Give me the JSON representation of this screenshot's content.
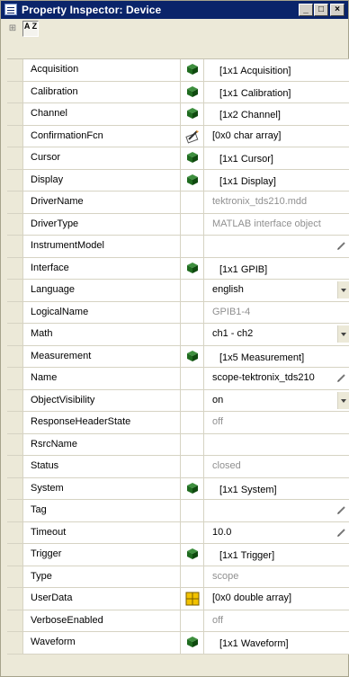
{
  "window": {
    "title": "Property Inspector:  Device",
    "buttons": [
      "_",
      "□",
      "×"
    ]
  },
  "toolbar": {
    "categorized_label": "⊞",
    "sort_label": "A Z"
  },
  "properties": [
    {
      "name": "Acquisition",
      "icon": "cube",
      "value": "[1x1 Acquisition]",
      "style": "sub"
    },
    {
      "name": "Calibration",
      "icon": "cube",
      "value": "[1x1 Calibration]",
      "style": "sub"
    },
    {
      "name": "Channel",
      "icon": "cube",
      "value": "[1x2 Channel]",
      "style": "sub"
    },
    {
      "name": "ConfirmationFcn",
      "icon": "edit",
      "value": "[0x0  char array]",
      "style": "normal"
    },
    {
      "name": "Cursor",
      "icon": "cube",
      "value": "[1x1 Cursor]",
      "style": "sub"
    },
    {
      "name": "Display",
      "icon": "cube",
      "value": "[1x1 Display]",
      "style": "sub"
    },
    {
      "name": "DriverName",
      "icon": "",
      "value": "tektronix_tds210.mdd",
      "style": "ro"
    },
    {
      "name": "DriverType",
      "icon": "",
      "value": "MATLAB interface object",
      "style": "ro"
    },
    {
      "name": "InstrumentModel",
      "icon": "",
      "value": "",
      "style": "normal",
      "pencil": true
    },
    {
      "name": "Interface",
      "icon": "cube",
      "value": "[1x1 GPIB]",
      "style": "sub"
    },
    {
      "name": "Language",
      "icon": "",
      "value": "english",
      "style": "normal",
      "dropdown": true
    },
    {
      "name": "LogicalName",
      "icon": "",
      "value": "GPIB1-4",
      "style": "ro"
    },
    {
      "name": "Math",
      "icon": "",
      "value": "ch1 - ch2",
      "style": "normal",
      "dropdown": true
    },
    {
      "name": "Measurement",
      "icon": "cube",
      "value": "[1x5 Measurement]",
      "style": "sub"
    },
    {
      "name": "Name",
      "icon": "",
      "value": "scope-tektronix_tds210",
      "style": "normal",
      "pencil": true
    },
    {
      "name": "ObjectVisibility",
      "icon": "",
      "value": "on",
      "style": "normal",
      "dropdown": true
    },
    {
      "name": "ResponseHeaderState",
      "icon": "",
      "value": "off",
      "style": "ro"
    },
    {
      "name": "RsrcName",
      "icon": "",
      "value": "",
      "style": "normal"
    },
    {
      "name": "Status",
      "icon": "",
      "value": "closed",
      "style": "ro"
    },
    {
      "name": "System",
      "icon": "cube",
      "value": "[1x1 System]",
      "style": "sub"
    },
    {
      "name": "Tag",
      "icon": "",
      "value": "",
      "style": "normal",
      "pencil": true
    },
    {
      "name": "Timeout",
      "icon": "",
      "value": "10.0",
      "style": "normal",
      "pencil": true
    },
    {
      "name": "Trigger",
      "icon": "cube",
      "value": "[1x1 Trigger]",
      "style": "sub"
    },
    {
      "name": "Type",
      "icon": "",
      "value": "scope",
      "style": "ro"
    },
    {
      "name": "UserData",
      "icon": "matrix",
      "value": "[0x0  double array]",
      "style": "normal"
    },
    {
      "name": "VerboseEnabled",
      "icon": "",
      "value": "off",
      "style": "ro"
    },
    {
      "name": "Waveform",
      "icon": "cube",
      "value": "[1x1 Waveform]",
      "style": "sub"
    }
  ],
  "colors": {
    "titlebar": "#0a246a",
    "cube": "#1f6b1f",
    "readonly_text": "#909090",
    "matrix_icon": "#f2c200"
  }
}
